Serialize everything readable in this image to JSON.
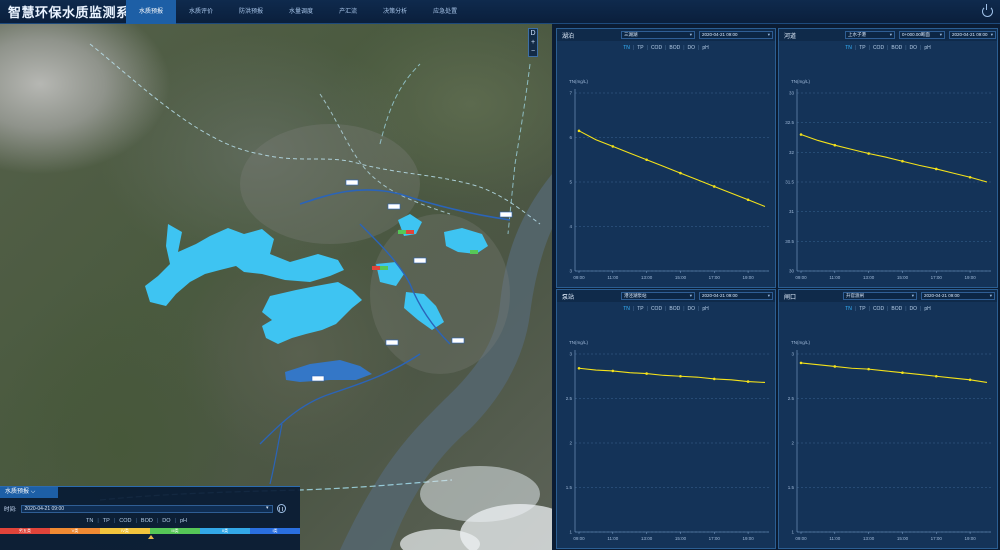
{
  "header": {
    "app_title": "智慧环保水质监测系统",
    "tabs": [
      {
        "label": "水质预报",
        "active": true
      },
      {
        "label": "水质评价",
        "active": false
      },
      {
        "label": "防洪预报",
        "active": false
      },
      {
        "label": "水量调度",
        "active": false
      },
      {
        "label": "产汇流",
        "active": false
      },
      {
        "label": "决策分析",
        "active": false
      },
      {
        "label": "应急处置",
        "active": false
      }
    ]
  },
  "map": {
    "controls": [
      "D",
      "+",
      "−"
    ],
    "panel": {
      "tab_label": "水质预报",
      "time_label": "时间:",
      "time_value": "2020-04-21 09:00",
      "params": [
        "TN",
        "TP",
        "COD",
        "BOD",
        "DO",
        "pH"
      ],
      "levels": [
        {
          "label": "劣五类",
          "color": "#e0443a"
        },
        {
          "label": "V类",
          "color": "#f08a33"
        },
        {
          "label": "IV类",
          "color": "#f2c43d"
        },
        {
          "label": "III类",
          "color": "#56c757"
        },
        {
          "label": "II类",
          "color": "#33a8e8"
        },
        {
          "label": "I类",
          "color": "#2a6fe0"
        }
      ]
    }
  },
  "panels": [
    {
      "title": "湖泊",
      "dropdowns": [
        "三湖湖",
        "2020-04-21 09:00"
      ],
      "tabs": [
        "TN",
        "TP",
        "COD",
        "BOD",
        "DO",
        "pH"
      ],
      "active_tab": "TN"
    },
    {
      "title": "河道",
      "dropdowns": [
        "上水子港",
        "0+000.00断面",
        "2020-04-21 09:00"
      ],
      "tabs": [
        "TN",
        "TP",
        "COD",
        "BOD",
        "DO",
        "pH"
      ],
      "active_tab": "TN"
    },
    {
      "title": "泵站",
      "dropdowns": [
        "港泾湖泵站",
        "2020-04-21 09:00"
      ],
      "tabs": [
        "TN",
        "TP",
        "COD",
        "BOD",
        "DO",
        "pH"
      ],
      "active_tab": "TN"
    },
    {
      "title": "闸口",
      "dropdowns": [
        "升官渡闸",
        "2020-04-21 09:00"
      ],
      "tabs": [
        "TN",
        "TP",
        "COD",
        "BOD",
        "DO",
        "pH"
      ],
      "active_tab": "TN"
    }
  ],
  "chart_data": [
    {
      "type": "line",
      "ylabel": "TN(mg/L)",
      "ylim": [
        3,
        7
      ],
      "yticks": [
        3,
        4,
        5,
        6,
        7
      ],
      "categories": [
        "09:00",
        "11:00",
        "13:00",
        "15:00",
        "17:00",
        "19:00"
      ],
      "x": [
        "09:00",
        "10:00",
        "11:00",
        "12:00",
        "13:00",
        "14:00",
        "15:00",
        "16:00",
        "17:00",
        "18:00",
        "19:00",
        "20:00"
      ],
      "series": [
        {
          "values": [
            6.15,
            5.95,
            5.8,
            5.65,
            5.5,
            5.35,
            5.2,
            5.05,
            4.9,
            4.75,
            4.6,
            4.45
          ],
          "color": "#f4e21a"
        }
      ],
      "marker_every": 2,
      "grid": true
    },
    {
      "type": "line",
      "ylabel": "TN(mg/L)",
      "ylim": [
        30,
        33
      ],
      "yticks": [
        30,
        30.5,
        31,
        31.5,
        32,
        32.5,
        33
      ],
      "categories": [
        "09:00",
        "11:00",
        "13:00",
        "15:00",
        "17:00",
        "19:00"
      ],
      "x": [
        "09:00",
        "10:00",
        "11:00",
        "12:00",
        "13:00",
        "14:00",
        "15:00",
        "16:00",
        "17:00",
        "18:00",
        "19:00",
        "20:00"
      ],
      "series": [
        {
          "values": [
            32.3,
            32.2,
            32.12,
            32.05,
            31.98,
            31.92,
            31.85,
            31.78,
            31.72,
            31.65,
            31.58,
            31.5
          ],
          "color": "#f4e21a"
        }
      ],
      "marker_every": 2,
      "grid": true
    },
    {
      "type": "line",
      "ylabel": "TN(mg/L)",
      "ylim": [
        1,
        3
      ],
      "yticks": [
        1,
        1.5,
        2,
        2.5,
        3
      ],
      "categories": [
        "09:00",
        "11:00",
        "13:00",
        "15:00",
        "17:00",
        "19:00"
      ],
      "x": [
        "09:00",
        "10:00",
        "11:00",
        "12:00",
        "13:00",
        "14:00",
        "15:00",
        "16:00",
        "17:00",
        "18:00",
        "19:00",
        "20:00"
      ],
      "series": [
        {
          "values": [
            2.84,
            2.82,
            2.81,
            2.79,
            2.78,
            2.76,
            2.75,
            2.74,
            2.72,
            2.71,
            2.69,
            2.68
          ],
          "color": "#f4e21a"
        }
      ],
      "marker_every": 2,
      "grid": true
    },
    {
      "type": "line",
      "ylabel": "TN(mg/L)",
      "ylim": [
        1,
        3
      ],
      "yticks": [
        1,
        1.5,
        2,
        2.5,
        3
      ],
      "categories": [
        "09:00",
        "11:00",
        "13:00",
        "15:00",
        "17:00",
        "19:00"
      ],
      "x": [
        "09:00",
        "10:00",
        "11:00",
        "12:00",
        "13:00",
        "14:00",
        "15:00",
        "16:00",
        "17:00",
        "18:00",
        "19:00",
        "20:00"
      ],
      "series": [
        {
          "values": [
            2.9,
            2.88,
            2.86,
            2.84,
            2.83,
            2.81,
            2.79,
            2.77,
            2.75,
            2.73,
            2.71,
            2.68
          ],
          "color": "#f4e21a"
        }
      ],
      "marker_every": 2,
      "grid": true
    }
  ]
}
